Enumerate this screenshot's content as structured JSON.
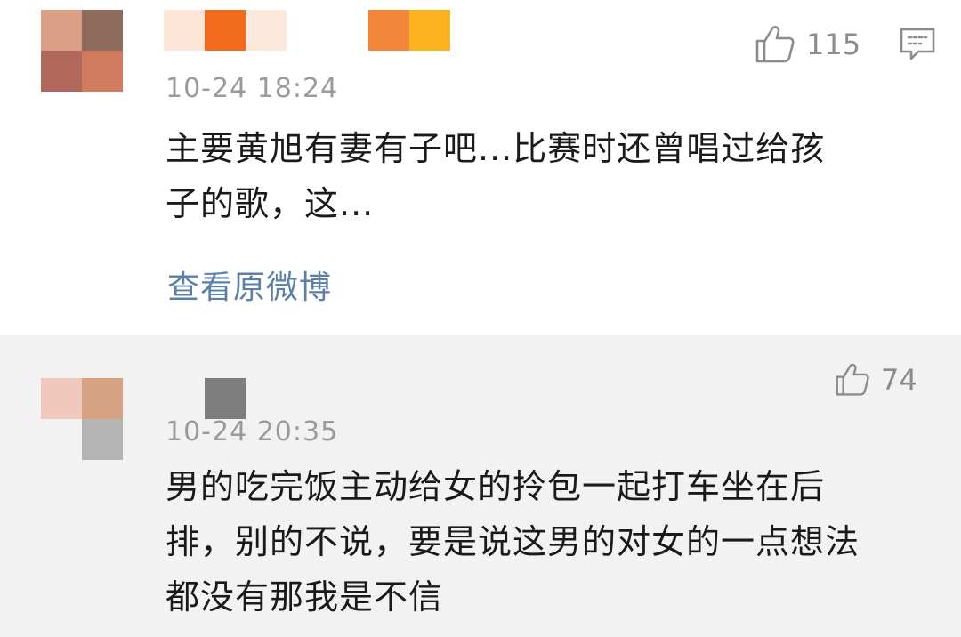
{
  "comments": [
    {
      "timestamp": "10-24 18:24",
      "text_line1": "主要黄旭有妻有子吧...比赛时还曾唱过给孩",
      "text_line2": "子的歌，这...",
      "link_label": "查看原微博",
      "like_count": "115",
      "avatar_colors": [
        "#d9a085",
        "#8e6a5c",
        "#b0685a",
        "#d07a5e"
      ],
      "username_colors": [
        "#fde6d8",
        "#f26a1b",
        "#fde9dc",
        "#f28638",
        "#fbb41f"
      ]
    },
    {
      "timestamp": "10-24 20:35",
      "text_line1": "男的吃完饭主动给女的拎包一起打车坐在后",
      "text_line2": "排，别的不说，要是说这男的对女的一点想法",
      "text_line3": "都没有那我是不信",
      "like_count": "74",
      "avatar_colors": [
        "#f1c8bc",
        "#d7a284",
        "#b4b4b4"
      ],
      "username_colors": [
        "#7e7e7e"
      ]
    }
  ],
  "icons": {
    "like": "thumbs-up-icon",
    "reply": "comment-icon"
  }
}
